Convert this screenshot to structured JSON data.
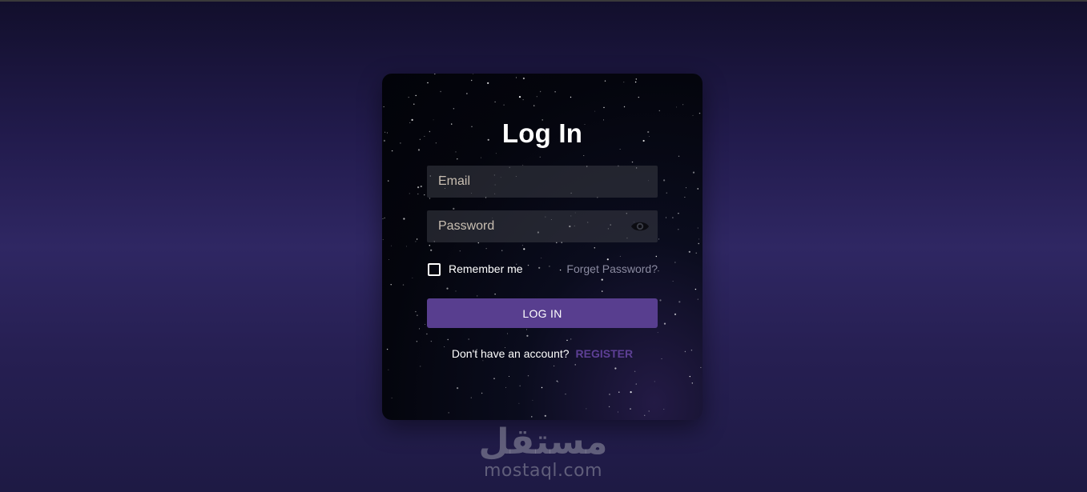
{
  "login_card": {
    "title": "Log In",
    "email": {
      "placeholder": "Email",
      "value": ""
    },
    "password": {
      "placeholder": "Password",
      "value": "",
      "toggle_icon": "eye-icon"
    },
    "remember_label": "Remember me",
    "remember_checked": false,
    "forgot_label": "Forget Password?",
    "submit_label": "LOG IN",
    "register_prompt": "Don't have an account?",
    "register_label": "REGISTER"
  },
  "watermark": {
    "arabic": "مستقل",
    "latin": "mostaql.com"
  },
  "colors": {
    "accent": "#583e8f",
    "register_link": "#5d3f95",
    "forgot_link": "#8a8aa0"
  }
}
